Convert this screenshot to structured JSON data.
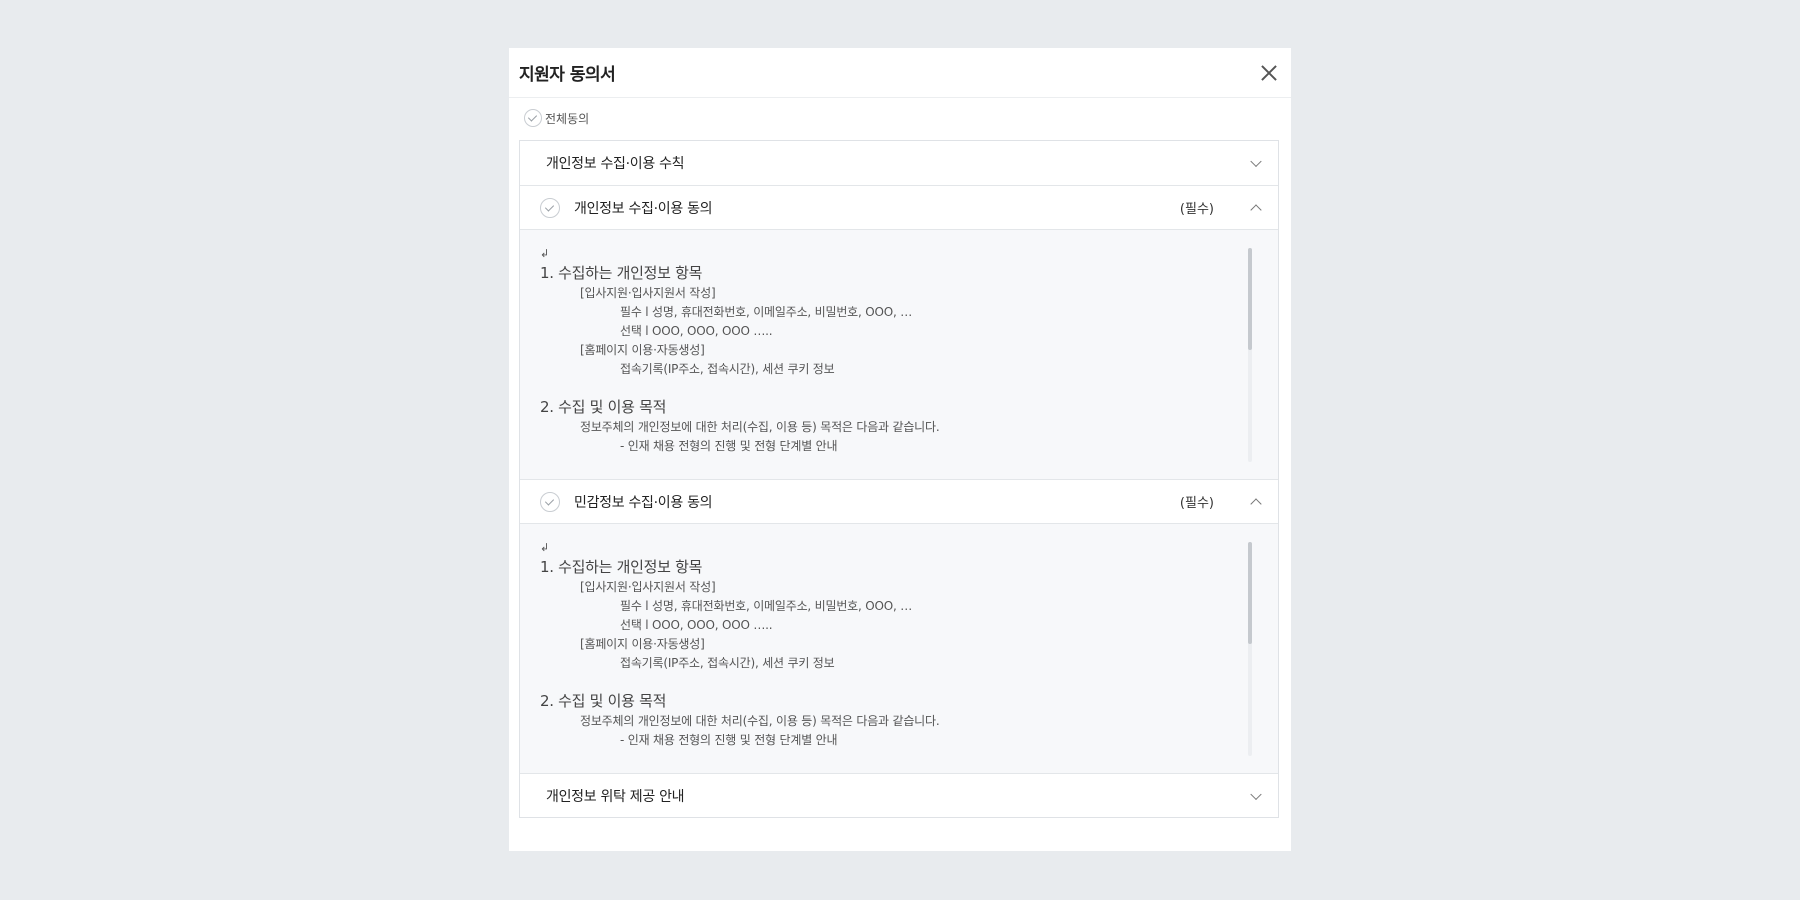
{
  "modal": {
    "title": "지원자 동의서",
    "agree_all_label": "전체동의"
  },
  "sections": [
    {
      "title": "개인정보 수집·이용 수칙",
      "expanded": false
    },
    {
      "title": "개인정보 수집·이용 동의",
      "required": "(필수)",
      "expanded": true
    },
    {
      "title": "민감정보 수집·이용 동의",
      "required": "(필수)",
      "expanded": true
    },
    {
      "title": "개인정보 위탁 제공 안내",
      "expanded": false
    }
  ],
  "terms": {
    "return_mark": "↲",
    "sec1": "1. 수집하는 개인정보 항목",
    "sec1_sub1": "[입사지원·입사지원서 작성]",
    "sec1_required": "필수 l 성명, 휴대전화번호, 이메일주소, 비밀번호, OOO, …",
    "sec1_optional": "선택 l OOO, OOO, OOO …..",
    "sec1_sub2": "[홈페이지 이용·자동생성]",
    "sec1_auto": "접속기록(IP주소, 접속시간), 세션 쿠키 정보",
    "sec2": "2. 수집 및 이용 목적",
    "sec2_desc": "정보주체의 개인정보에 대한 처리(수집, 이용 등) 목적은 다음과 같습니다.",
    "sec2_item1": "- 인재 채용 전형의 진행 및 전형 단계별 안내"
  },
  "colors": {
    "backdrop": "#e8ebee",
    "panel_body": "#f7f8fa",
    "border": "#dfe2e6"
  }
}
